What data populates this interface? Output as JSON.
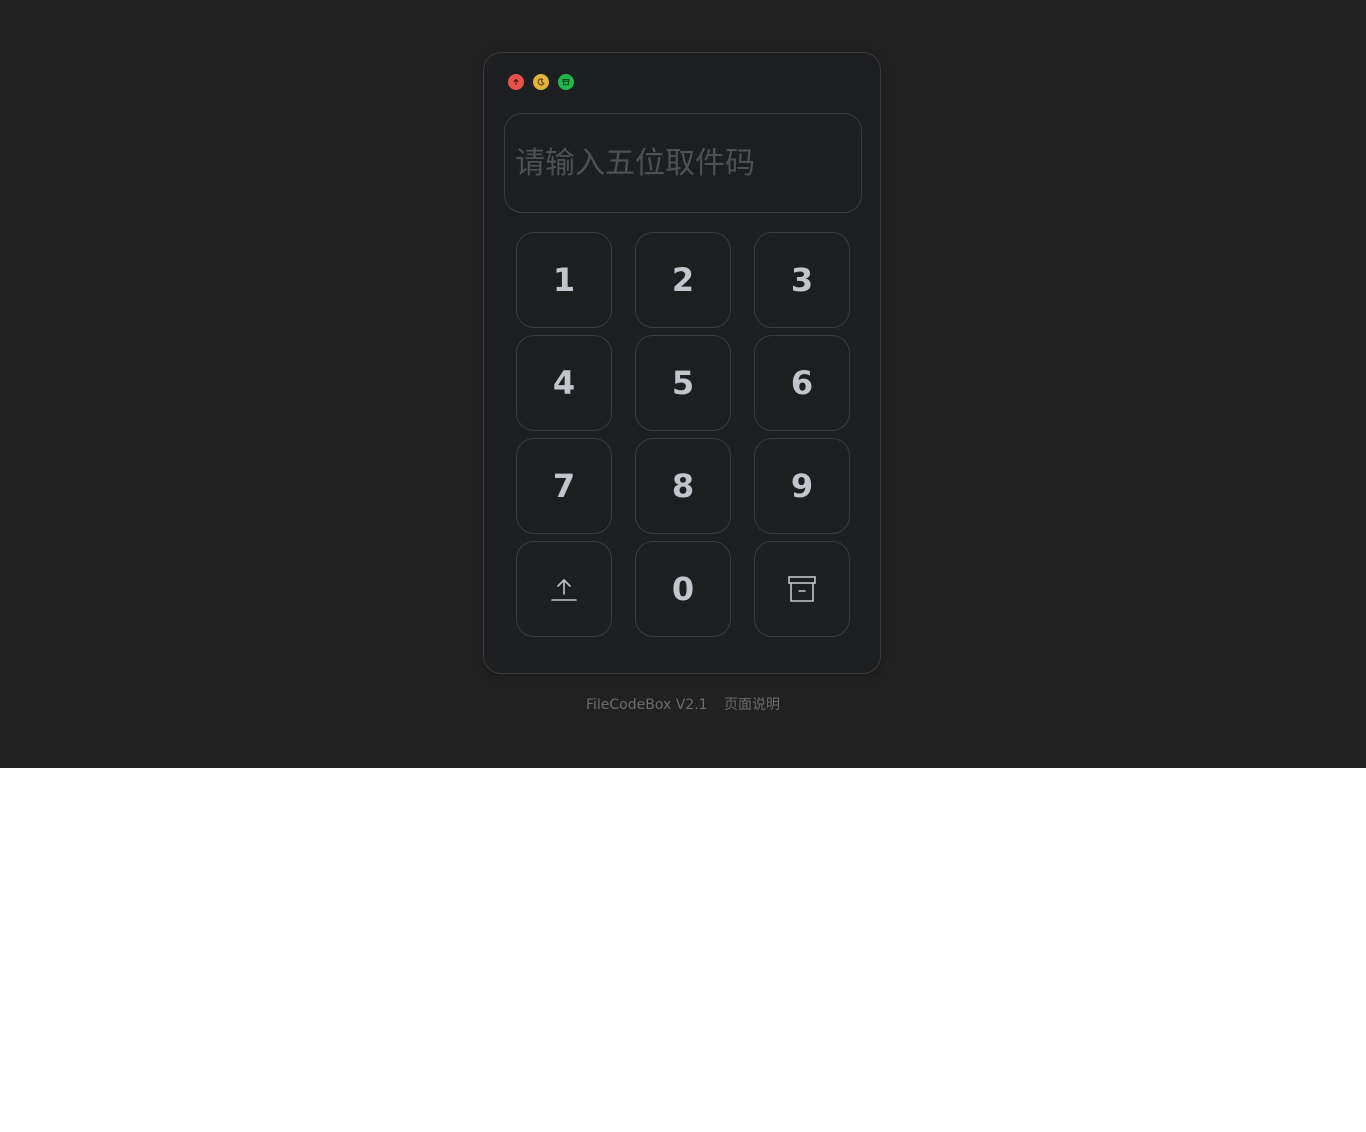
{
  "window_controls": {
    "close_color": "#e5534b",
    "theme_color": "#e2b33a",
    "archive_color": "#1fb84a",
    "close_icon": "upload-icon",
    "theme_icon": "moon-icon",
    "archive_icon": "archive-icon"
  },
  "code_input": {
    "placeholder": "请输入五位取件码",
    "value": ""
  },
  "keypad": {
    "keys": [
      "1",
      "2",
      "3",
      "4",
      "5",
      "6",
      "7",
      "8",
      "9"
    ],
    "upload_icon": "upload-icon",
    "zero": "0",
    "archive_icon": "archive-icon"
  },
  "footer": {
    "version": "FileCodeBox V2.1",
    "about": "页面说明"
  }
}
